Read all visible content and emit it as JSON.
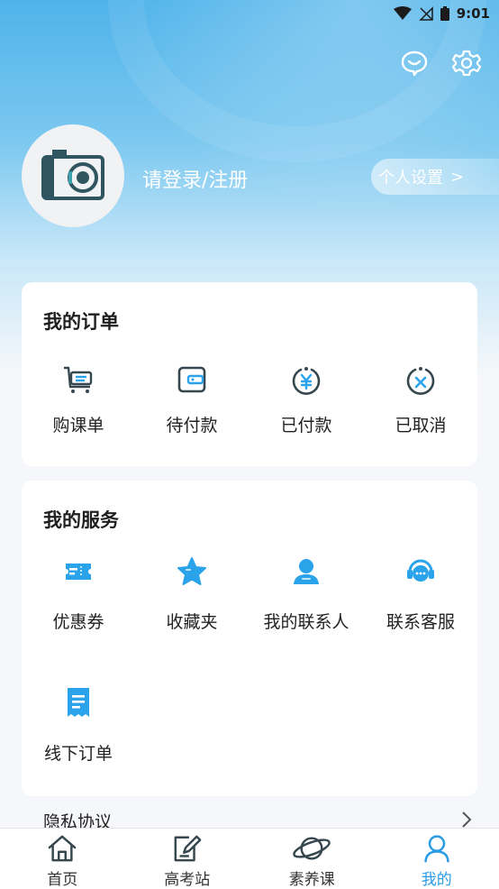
{
  "status_bar": {
    "time": "9:01"
  },
  "profile": {
    "login_text": "请登录/注册",
    "settings_label": "个人设置",
    "settings_arrow": ">"
  },
  "orders": {
    "title": "我的订单",
    "items": [
      {
        "label": "购课单",
        "icon": "cart-icon"
      },
      {
        "label": "待付款",
        "icon": "wallet-icon"
      },
      {
        "label": "已付款",
        "icon": "paid-icon"
      },
      {
        "label": "已取消",
        "icon": "cancelled-icon"
      }
    ]
  },
  "services": {
    "title": "我的服务",
    "items": [
      {
        "label": "优惠券",
        "icon": "coupon-icon"
      },
      {
        "label": "收藏夹",
        "icon": "star-icon"
      },
      {
        "label": "我的联系人",
        "icon": "contact-icon"
      },
      {
        "label": "联系客服",
        "icon": "customer-service-icon"
      },
      {
        "label": "线下订单",
        "icon": "receipt-icon"
      }
    ]
  },
  "privacy": {
    "label": "隐私协议"
  },
  "bottom_nav": {
    "items": [
      {
        "label": "首页",
        "icon": "home-icon",
        "active": false
      },
      {
        "label": "高考站",
        "icon": "edit-icon",
        "active": false
      },
      {
        "label": "素养课",
        "icon": "planet-icon",
        "active": false
      },
      {
        "label": "我的",
        "icon": "profile-icon",
        "active": true
      }
    ]
  },
  "colors": {
    "accent": "#2b9be6",
    "header_top": "#4fb3ea",
    "icon_blue": "#2aa3ea"
  }
}
